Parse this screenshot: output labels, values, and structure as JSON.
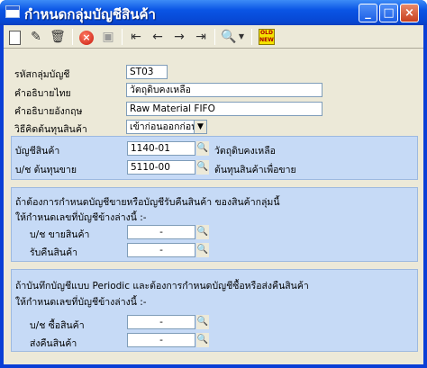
{
  "window": {
    "title": "กำหนดกลุ่มบัญชีสินค้า",
    "minimize_label": "_",
    "maximize_label": "□",
    "close_label": "×"
  },
  "toolbar": {
    "oldnew_label": "OLD NEW",
    "icons": [
      "new-document-icon",
      "edit-icon",
      "trash-icon",
      "delete-icon",
      "save-icon",
      "first-record-icon",
      "prev-record-icon",
      "next-record-icon",
      "last-record-icon",
      "search-icon",
      "dropdown-icon",
      "oldnew-icon"
    ]
  },
  "header": {
    "group_code_label": "รหัสกลุ่มบัญชี",
    "group_code_value": "ST03",
    "desc_thai_label": "คำอธิบายไทย",
    "desc_thai_value": "วัตถุดิบคงเหลือ",
    "desc_eng_label": "คำอธิบายอังกฤษ",
    "desc_eng_value": "Raw Material FIFO",
    "cost_method_label": "วิธีคิดต้นทุนสินค้า",
    "cost_method_value": "เข้าก่อนออกก่อน"
  },
  "accounts_panel": {
    "inventory_label": "บัญชีสินค้า",
    "inventory_value": "1140-01",
    "inventory_desc": "วัตถุดิบคงเหลือ",
    "cogs_label": "บ/ช ต้นทุนขาย",
    "cogs_value": "5110-00",
    "cogs_desc": "ต้นทุนสินค้าเพื่อขาย"
  },
  "sales_panel": {
    "line1": "ถ้าต้องการกำหนดบัญชีขายหรือบัญชีรับคืนสินค้า ของสินค้ากลุ่มนี้",
    "line2": "ให้กำหนดเลขที่บัญชีข้างล่างนี้ :-",
    "sales_label": "บ/ช ขายสินค้า",
    "sales_value": "-",
    "return_label": "รับคืนสินค้า",
    "return_value": "-"
  },
  "purchase_panel": {
    "line1": "ถ้าบันทึกบัญชีแบบ Periodic และต้องการกำหนดบัญชีซื้อหรือส่งคืนสินค้า",
    "line2": "ให้กำหนดเลขที่บัญชีข้างล่างนี้ :-",
    "purchase_label": "บ/ช ซื้อสินค้า",
    "purchase_value": "-",
    "purchase_return_label": "ส่งคืนสินค้า",
    "purchase_return_value": "-"
  },
  "colors": {
    "titlebar": "#0a55e5",
    "panel": "#c6daf6",
    "client": "#ece9d8"
  }
}
